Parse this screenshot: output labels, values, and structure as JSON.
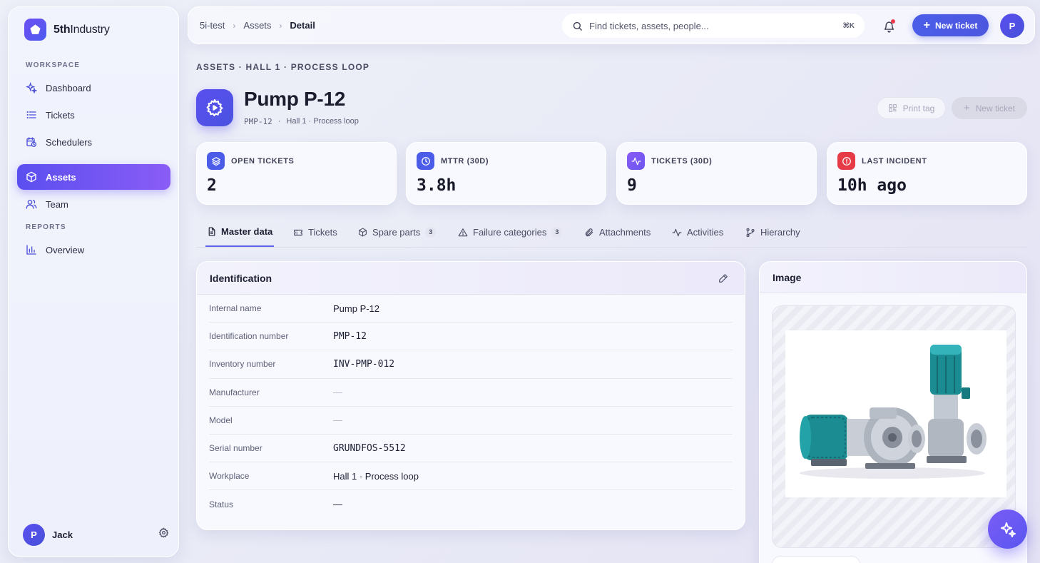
{
  "app": {
    "brand_bold": "5th",
    "brand_light": "Industry"
  },
  "sidebar": {
    "section_workspace": "WORKSPACE",
    "section_reports": "REPORTS",
    "items": [
      {
        "label": "Dashboard",
        "icon": "sparkle-icon"
      },
      {
        "label": "Tickets",
        "icon": "list-icon"
      },
      {
        "label": "Schedulers",
        "icon": "calendar-clock-icon"
      },
      {
        "label": "Assets",
        "icon": "box-icon",
        "active": true
      },
      {
        "label": "Team",
        "icon": "users-icon"
      }
    ],
    "reports": [
      {
        "label": "Overview",
        "icon": "bar-chart-icon"
      }
    ],
    "user": {
      "initial": "P",
      "name": "Jack"
    }
  },
  "topbar": {
    "breadcrumb": [
      "5i-test",
      "Assets",
      "Detail"
    ],
    "search_placeholder": "Find tickets, assets, people...",
    "shortcut": "⌘K",
    "new_ticket_label": "New ticket",
    "avatar_initial": "P"
  },
  "header": {
    "path": "ASSETS · HALL 1 · PROCESS LOOP",
    "title": "Pump P-12",
    "code": "PMP-12",
    "separator": "·",
    "location": "Hall 1 · Process loop",
    "print_tag_label": "Print tag",
    "new_ticket_label": "New ticket"
  },
  "stats": [
    {
      "label": "OPEN TICKETS",
      "value": "2",
      "color": "#4b5de8"
    },
    {
      "label": "MTTR (30D)",
      "value": "3.8h",
      "color": "#4b5de8"
    },
    {
      "label": "TICKETS (30D)",
      "value": "9",
      "color": "#7a5cf7"
    },
    {
      "label": "LAST INCIDENT",
      "value": "10h ago",
      "color": "#e63a47"
    }
  ],
  "tabs": [
    {
      "label": "Master data",
      "active": true
    },
    {
      "label": "Tickets"
    },
    {
      "label": "Spare parts",
      "badge": "3"
    },
    {
      "label": "Failure categories",
      "badge": "3"
    },
    {
      "label": "Attachments"
    },
    {
      "label": "Activities"
    },
    {
      "label": "Hierarchy"
    }
  ],
  "identification": {
    "title": "Identification",
    "fields": [
      {
        "label": "Internal name",
        "value": "Pump P-12"
      },
      {
        "label": "Identification number",
        "value": "PMP-12",
        "mono": true
      },
      {
        "label": "Inventory number",
        "value": "INV-PMP-012",
        "mono": true
      },
      {
        "label": "Manufacturer",
        "value": "—",
        "dim": true
      },
      {
        "label": "Model",
        "value": "—",
        "dim": true
      },
      {
        "label": "Serial number",
        "value": "GRUNDFOS-5512",
        "mono": true
      },
      {
        "label": "Workplace",
        "value": "Hall 1 · Process loop"
      },
      {
        "label": "Status",
        "value": "—"
      }
    ]
  },
  "image_card": {
    "title": "Image"
  },
  "colors": {
    "accent": "#5b4ff0",
    "primary_button": "#4b5de8",
    "danger": "#e63a47"
  }
}
